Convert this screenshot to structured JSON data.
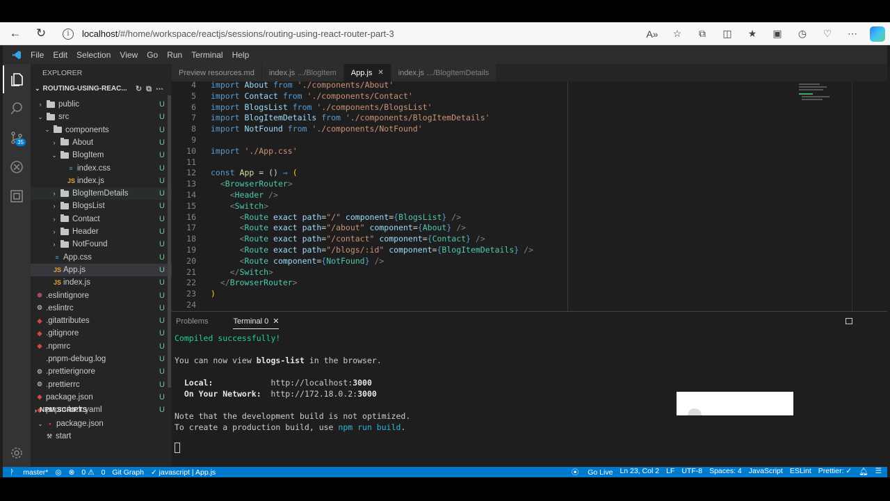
{
  "browser": {
    "url_host": "localhost",
    "url_path": "/#/home/workspace/reactjs/sessions/routing-using-react-router-part-3"
  },
  "menu": [
    "File",
    "Edit",
    "Selection",
    "View",
    "Go",
    "Run",
    "Terminal",
    "Help"
  ],
  "activity": {
    "source_control_badge": "35"
  },
  "explorer": {
    "title": "EXPLORER",
    "section": "ROUTING-USING-REAC...",
    "tree": [
      {
        "label": "public",
        "kind": "folder",
        "open": false,
        "depth": 0,
        "status": "U"
      },
      {
        "label": "src",
        "kind": "folder",
        "open": true,
        "depth": 0,
        "status": "U"
      },
      {
        "label": "components",
        "kind": "folder",
        "open": true,
        "depth": 1,
        "status": "U"
      },
      {
        "label": "About",
        "kind": "folder",
        "open": false,
        "depth": 2,
        "status": "U"
      },
      {
        "label": "BlogItem",
        "kind": "folder",
        "open": true,
        "depth": 2,
        "status": "U"
      },
      {
        "label": "index.css",
        "kind": "css",
        "depth": 3,
        "status": "U"
      },
      {
        "label": "index.js",
        "kind": "js",
        "depth": 3,
        "status": "U"
      },
      {
        "label": "BlogItemDetails",
        "kind": "folder",
        "open": false,
        "depth": 2,
        "status": "U",
        "hover": true
      },
      {
        "label": "BlogsList",
        "kind": "folder",
        "open": false,
        "depth": 2,
        "status": "U"
      },
      {
        "label": "Contact",
        "kind": "folder",
        "open": false,
        "depth": 2,
        "status": "U"
      },
      {
        "label": "Header",
        "kind": "folder",
        "open": false,
        "depth": 2,
        "status": "U"
      },
      {
        "label": "NotFound",
        "kind": "folder",
        "open": false,
        "depth": 2,
        "status": "U"
      },
      {
        "label": "App.css",
        "kind": "css",
        "depth": 1,
        "status": "U"
      },
      {
        "label": "App.js",
        "kind": "js",
        "depth": 1,
        "status": "U",
        "selected": true
      },
      {
        "label": "index.js",
        "kind": "js",
        "depth": 1,
        "status": "U"
      },
      {
        "label": ".eslintignore",
        "kind": "pink",
        "depth": 0,
        "status": "U"
      },
      {
        "label": ".eslintrc",
        "kind": "gear",
        "depth": 0,
        "status": "U"
      },
      {
        "label": ".gitattributes",
        "kind": "red",
        "depth": 0,
        "status": "U"
      },
      {
        "label": ".gitignore",
        "kind": "red",
        "depth": 0,
        "status": "U"
      },
      {
        "label": ".npmrc",
        "kind": "red",
        "depth": 0,
        "status": "U"
      },
      {
        "label": ".pnpm-debug.log",
        "kind": "none",
        "depth": 0,
        "status": "U"
      },
      {
        "label": ".prettierignore",
        "kind": "gear",
        "depth": 0,
        "status": "U"
      },
      {
        "label": ".prettierrc",
        "kind": "gear",
        "depth": 0,
        "status": "U"
      },
      {
        "label": "package.json",
        "kind": "red",
        "depth": 0,
        "status": "U"
      },
      {
        "label": "pnpm-lock.yaml",
        "kind": "red",
        "depth": 0,
        "status": "U"
      }
    ],
    "npm_title": "NPM SCRIPTS",
    "npm_pkg": "package.json",
    "npm_script": "start"
  },
  "tabs": [
    {
      "name": "Preview resources.md",
      "dim": "",
      "active": false
    },
    {
      "name": "index.js",
      "dim": ".../BlogItem",
      "active": false
    },
    {
      "name": "App.js",
      "dim": "",
      "active": true
    },
    {
      "name": "index.js",
      "dim": ".../BlogItemDetails",
      "active": false
    }
  ],
  "code": [
    {
      "n": "4",
      "toks": [
        [
          "k",
          "import "
        ],
        [
          "a",
          "About "
        ],
        [
          "k",
          "from "
        ],
        [
          "s",
          "'./components/About'"
        ]
      ]
    },
    {
      "n": "5",
      "toks": [
        [
          "k",
          "import "
        ],
        [
          "a",
          "Contact "
        ],
        [
          "k",
          "from "
        ],
        [
          "s",
          "'./components/Contact'"
        ]
      ]
    },
    {
      "n": "6",
      "toks": [
        [
          "k",
          "import "
        ],
        [
          "a",
          "BlogsList "
        ],
        [
          "k",
          "from "
        ],
        [
          "s",
          "'./components/BlogsList'"
        ]
      ]
    },
    {
      "n": "7",
      "toks": [
        [
          "k",
          "import "
        ],
        [
          "a",
          "BlogItemDetails "
        ],
        [
          "k",
          "from "
        ],
        [
          "s",
          "'./components/BlogItemDetails'"
        ]
      ]
    },
    {
      "n": "8",
      "toks": [
        [
          "k",
          "import "
        ],
        [
          "a",
          "NotFound "
        ],
        [
          "k",
          "from "
        ],
        [
          "s",
          "'./components/NotFound'"
        ]
      ]
    },
    {
      "n": "9",
      "toks": []
    },
    {
      "n": "10",
      "toks": [
        [
          "k",
          "import "
        ],
        [
          "s",
          "'./App.css'"
        ]
      ]
    },
    {
      "n": "11",
      "toks": []
    },
    {
      "n": "12",
      "toks": [
        [
          "k",
          "const "
        ],
        [
          "f",
          "App "
        ],
        [
          "",
          "= () "
        ],
        [
          "k",
          "⇒ "
        ],
        [
          "y",
          "("
        ]
      ]
    },
    {
      "n": "13",
      "toks": [
        [
          "",
          "  "
        ],
        [
          "b",
          "<"
        ],
        [
          "t",
          "BrowserRouter"
        ],
        [
          "b",
          ">"
        ]
      ]
    },
    {
      "n": "14",
      "toks": [
        [
          "",
          "    "
        ],
        [
          "b",
          "<"
        ],
        [
          "t",
          "Header "
        ],
        [
          "b",
          "/>"
        ]
      ]
    },
    {
      "n": "15",
      "toks": [
        [
          "",
          "    "
        ],
        [
          "b",
          "<"
        ],
        [
          "t",
          "Switch"
        ],
        [
          "b",
          ">"
        ]
      ]
    },
    {
      "n": "16",
      "toks": [
        [
          "",
          "      "
        ],
        [
          "b",
          "<"
        ],
        [
          "t",
          "Route "
        ],
        [
          "a",
          "exact path"
        ],
        [
          "",
          "="
        ],
        [
          "s",
          "\"/\" "
        ],
        [
          "a",
          "component"
        ],
        [
          "",
          "="
        ],
        [
          "k",
          "{"
        ],
        [
          "t",
          "BlogsList"
        ],
        [
          "k",
          "}"
        ],
        [
          "b",
          " />"
        ]
      ]
    },
    {
      "n": "17",
      "toks": [
        [
          "",
          "      "
        ],
        [
          "b",
          "<"
        ],
        [
          "t",
          "Route "
        ],
        [
          "a",
          "exact path"
        ],
        [
          "",
          "="
        ],
        [
          "s",
          "\"/about\" "
        ],
        [
          "a",
          "component"
        ],
        [
          "",
          "="
        ],
        [
          "k",
          "{"
        ],
        [
          "t",
          "About"
        ],
        [
          "k",
          "}"
        ],
        [
          "b",
          " />"
        ]
      ]
    },
    {
      "n": "18",
      "toks": [
        [
          "",
          "      "
        ],
        [
          "b",
          "<"
        ],
        [
          "t",
          "Route "
        ],
        [
          "a",
          "exact path"
        ],
        [
          "",
          "="
        ],
        [
          "s",
          "\"/contact\" "
        ],
        [
          "a",
          "component"
        ],
        [
          "",
          "="
        ],
        [
          "k",
          "{"
        ],
        [
          "t",
          "Contact"
        ],
        [
          "k",
          "}"
        ],
        [
          "b",
          " />"
        ]
      ]
    },
    {
      "n": "19",
      "toks": [
        [
          "",
          "      "
        ],
        [
          "b",
          "<"
        ],
        [
          "t",
          "Route "
        ],
        [
          "a",
          "exact path"
        ],
        [
          "",
          "="
        ],
        [
          "s",
          "\"/blogs/:id\" "
        ],
        [
          "a",
          "component"
        ],
        [
          "",
          "="
        ],
        [
          "k",
          "{"
        ],
        [
          "t",
          "BlogItemDetails"
        ],
        [
          "k",
          "}"
        ],
        [
          "b",
          " />"
        ]
      ]
    },
    {
      "n": "20",
      "toks": [
        [
          "",
          "      "
        ],
        [
          "b",
          "<"
        ],
        [
          "t",
          "Route "
        ],
        [
          "a",
          "component"
        ],
        [
          "",
          "="
        ],
        [
          "k",
          "{"
        ],
        [
          "t",
          "NotFound"
        ],
        [
          "k",
          "}"
        ],
        [
          "b",
          " />"
        ]
      ]
    },
    {
      "n": "21",
      "toks": [
        [
          "",
          "    "
        ],
        [
          "b",
          "</"
        ],
        [
          "t",
          "Switch"
        ],
        [
          "b",
          ">"
        ]
      ]
    },
    {
      "n": "22",
      "toks": [
        [
          "",
          "  "
        ],
        [
          "b",
          "</"
        ],
        [
          "t",
          "BrowserRouter"
        ],
        [
          "b",
          ">"
        ]
      ]
    },
    {
      "n": "23",
      "toks": [
        [
          "y",
          ")"
        ]
      ]
    },
    {
      "n": "24",
      "toks": []
    }
  ],
  "panel": {
    "tab_problems": "Problems",
    "tab_terminal": "Terminal 0",
    "lines": [
      [
        [
          "green",
          "Compiled successfully!"
        ]
      ],
      [],
      [
        [
          "",
          "You can now view "
        ],
        [
          "bold",
          "blogs-list"
        ],
        [
          "",
          " in the browser."
        ]
      ],
      [],
      [
        [
          "bold",
          "  Local:            "
        ],
        [
          "",
          "http://localhost:"
        ],
        [
          "bold",
          "3000"
        ]
      ],
      [
        [
          "bold",
          "  On Your Network:  "
        ],
        [
          "",
          "http://172.18.0.2:"
        ],
        [
          "bold",
          "3000"
        ]
      ],
      [],
      [
        [
          "",
          "Note that the development build is not optimized."
        ]
      ],
      [
        [
          "",
          "To create a production build, use "
        ],
        [
          "cyan",
          "npm run build"
        ],
        [
          "",
          "."
        ]
      ]
    ]
  },
  "status": {
    "branch": "master*",
    "errors": "0",
    "warnings": "0",
    "gitgraph": "Git Graph",
    "lang_file": "✓ javascript | App.js",
    "golive": "Go Live",
    "pos": "Ln 23, Col 2",
    "eol": "LF",
    "enc": "UTF-8",
    "spaces": "Spaces: 4",
    "lang": "JavaScript",
    "eslint": "ESLint",
    "prettier": "Prettier: ✓"
  }
}
